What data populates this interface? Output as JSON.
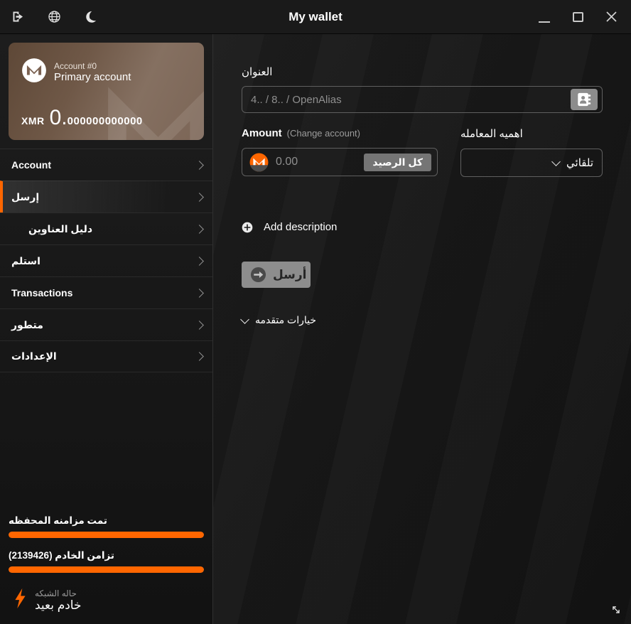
{
  "titlebar": {
    "title": "My wallet",
    "icons": {
      "logout": "logout-icon",
      "language": "globe-icon",
      "theme": "moon-icon"
    },
    "window_controls": [
      "minimize",
      "maximize",
      "close"
    ]
  },
  "sidebar": {
    "account_card": {
      "account_number": "Account #0",
      "account_name": "Primary account",
      "currency": "XMR",
      "balance_int": "0.",
      "balance_frac": "000000000000"
    },
    "menu": [
      {
        "label": "Account"
      },
      {
        "label": "إرسل",
        "active": true
      },
      {
        "label": "دليل العناوين",
        "indent": true
      },
      {
        "label": "استلم"
      },
      {
        "label": "Transactions"
      },
      {
        "label": "متطور"
      },
      {
        "label": "الإعدادات"
      }
    ],
    "status": {
      "wallet_sync_label": "تمت مزامنه المحفظه",
      "wallet_sync_progress": "100",
      "daemon_sync_label": "تزامن الخادم (2139426)",
      "daemon_sync_progress": "100",
      "network_status_title": "حاله الشبكه",
      "network_status_value": "خادم بعيد"
    }
  },
  "main": {
    "address": {
      "label": "العنوان",
      "placeholder": "4.. / 8.. / OpenAlias",
      "value": ""
    },
    "amount": {
      "label": "Amount",
      "sublabel": "(Change account)",
      "placeholder": "0.00",
      "value": "",
      "all_balance_label": "كل الرصيد"
    },
    "priority": {
      "label": "اهميه المعامله",
      "value": "تلقائي"
    },
    "add_description_label": "Add description",
    "send_label": "أرسل",
    "advanced_label": "خيارات متقدمه"
  },
  "colors": {
    "accent": "#ff6600",
    "card_brown": "#6f5847",
    "button_gray": "#8d8d8d"
  }
}
